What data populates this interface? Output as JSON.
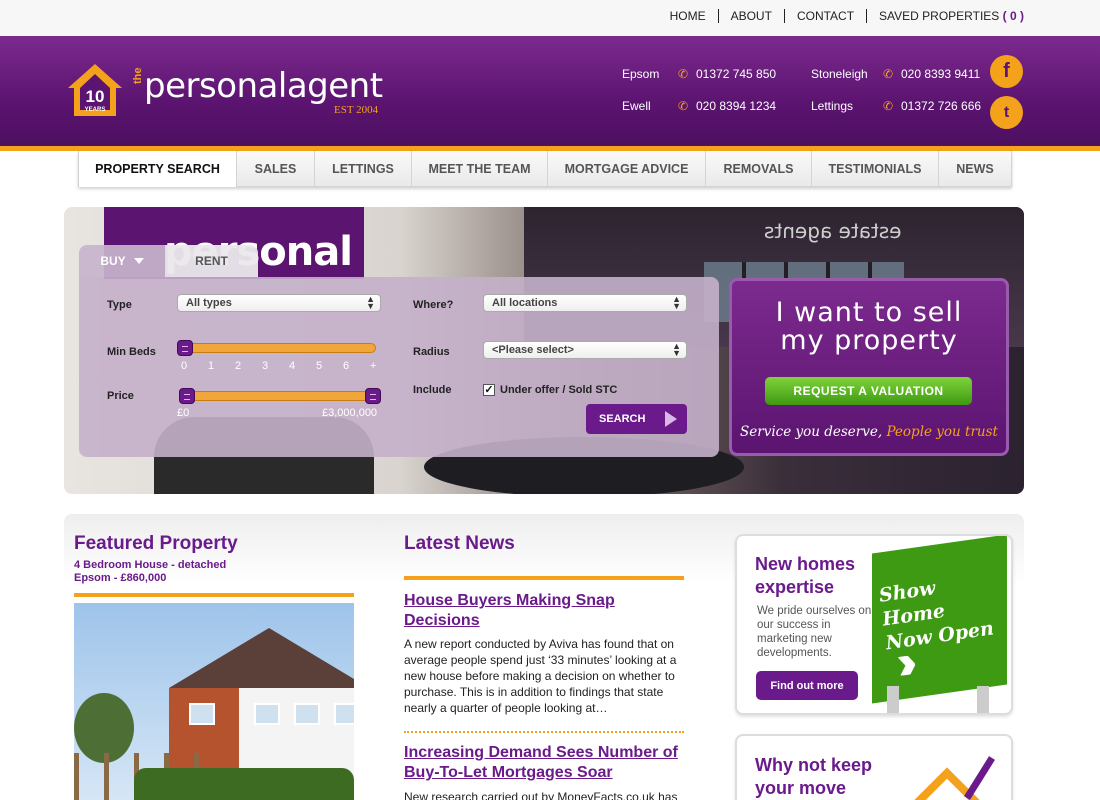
{
  "top_nav": {
    "home": "HOME",
    "about": "ABOUT",
    "contact": "CONTACT",
    "saved": "SAVED PROPERTIES",
    "saved_count": "( 0 )"
  },
  "logo": {
    "badge": "10",
    "badge_sub": "YEARS",
    "the": "the",
    "name": "personalagent",
    "est": "EST 2004"
  },
  "contacts": [
    {
      "place": "Epsom",
      "phone": "01372 745 850"
    },
    {
      "place": "Stoneleigh",
      "phone": "020 8393 9411"
    },
    {
      "place": "Ewell",
      "phone": "020 8394 1234"
    },
    {
      "place": "Lettings",
      "phone": "01372 726 666"
    }
  ],
  "social": {
    "facebook": "f",
    "twitter": "t"
  },
  "main_nav": [
    "PROPERTY SEARCH",
    "SALES",
    "LETTINGS",
    "MEET THE TEAM",
    "MORTGAGE ADVICE",
    "REMOVALS",
    "TESTIMONIALS",
    "NEWS"
  ],
  "hero": {
    "sign": "personal",
    "window_text": "estate agents"
  },
  "search": {
    "tab_buy": "BUY",
    "tab_rent": "RENT",
    "type_label": "Type",
    "type_value": "All types",
    "where_label": "Where?",
    "where_value": "All locations",
    "minbeds_label": "Min Beds",
    "bed_ticks": [
      "0",
      "1",
      "2",
      "3",
      "4",
      "5",
      "6",
      "+"
    ],
    "minbeds_value": 0,
    "radius_label": "Radius",
    "radius_value": "<Please select>",
    "price_label": "Price",
    "price_min": "£0",
    "price_max": "£3,000,000",
    "include_label": "Include",
    "include_option": "Under offer / Sold STC",
    "include_checked": true,
    "search_button": "SEARCH"
  },
  "sell": {
    "title_line1": "I want to sell",
    "title_line2": "my property",
    "button": "REQUEST A VALUATION",
    "tagline_a": "Service you deserve,",
    "tagline_b": "People you trust"
  },
  "featured": {
    "title": "Featured Property",
    "desc": "4 Bedroom House - detached",
    "location_price": "Epsom - £860,000"
  },
  "news": {
    "title": "Latest News",
    "items": [
      {
        "headline": "House Buyers Making Snap Decisions",
        "body": "A new report conducted by Aviva has found that on average people spend just ‘33 minutes’ looking at a new house before making a decision on whether to purchase. This is in addition to findings that state nearly a quarter of people looking at…"
      },
      {
        "headline": "Increasing Demand Sees Number of Buy-To-Let Mortgages Soar",
        "body": "New research carried out by MoneyFacts.co.uk has"
      }
    ]
  },
  "promo1": {
    "title": "New homes expertise",
    "text": "We pride ourselves on our success in marketing new developments.",
    "button": "Find out more",
    "sign": "Show Home Now Open"
  },
  "promo2": {
    "title": "Why not keep your move"
  },
  "colors": {
    "purple": "#6a1a8a",
    "orange": "#f4a21c",
    "green": "#3e9a12"
  }
}
